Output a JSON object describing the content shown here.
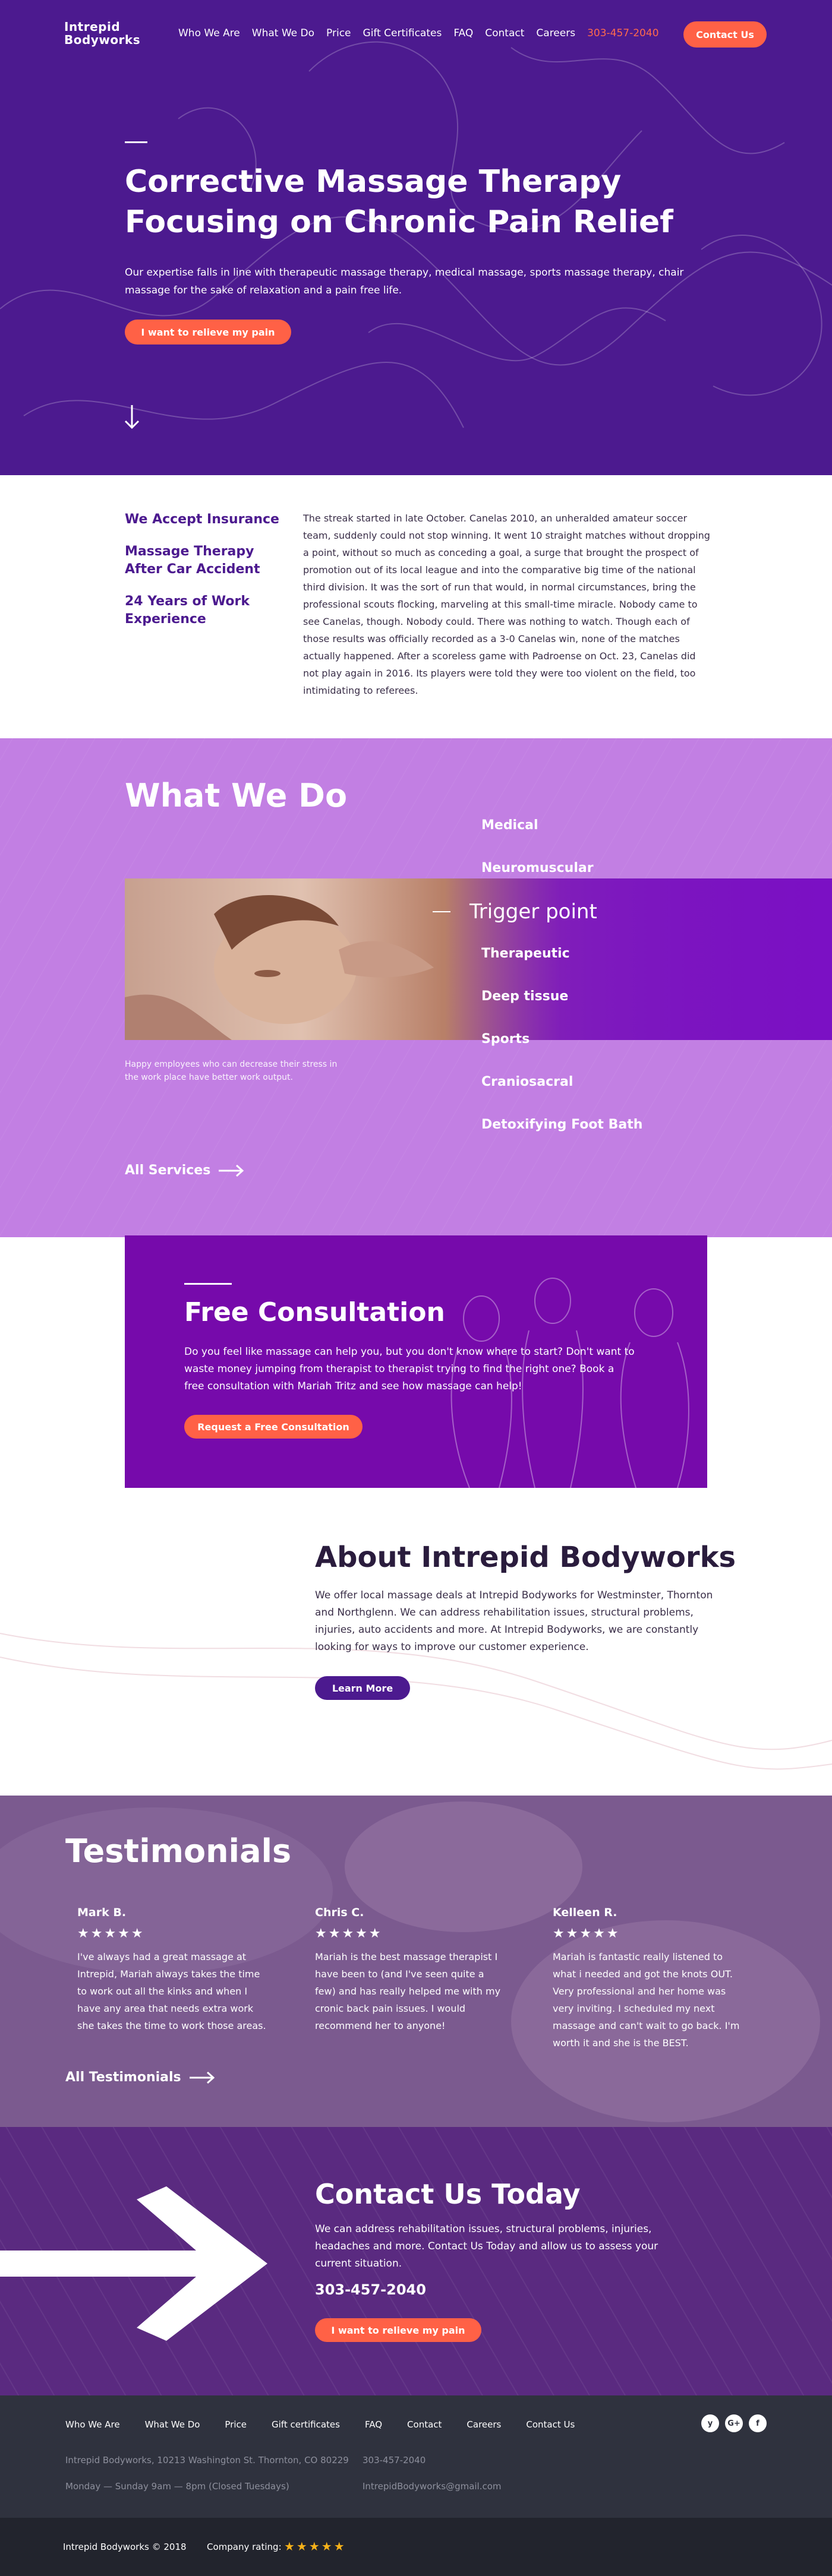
{
  "header": {
    "logo_line1": "Intrepid",
    "logo_line2": "Bodyworks",
    "nav": [
      "Who We Are",
      "What We Do",
      "Price",
      "Gift Certificates",
      "FAQ",
      "Contact",
      "Careers"
    ],
    "phone": "303-457-2040",
    "contact_button": "Contact Us"
  },
  "hero": {
    "title": "Corrective Massage Therapy Focusing on Chronic Pain Relief",
    "subtitle": "Our expertise falls in line with therapeutic massage therapy, medical massage, sports massage therapy, chair massage for the sake of relaxation and a pain free life.",
    "cta": "I want to relieve my pain"
  },
  "features": {
    "items": [
      "We Accept Insurance",
      "Massage Therapy After Car Accident",
      "24 Years of Work Experience"
    ],
    "text": "The streak started in late October. Canelas 2010, an unheralded amateur soccer team, suddenly could not stop winning. It went 10 straight matches without dropping a point, without so much as conceding a goal, a surge that brought the prospect of promotion out of its local league and into the comparative big time of the national third division. It was the sort of run that would, in normal circumstances, bring the professional scouts flocking, marveling at this small-time miracle. Nobody came to see Canelas, though. Nobody could. There was nothing to watch. Though each of those results was officially recorded as a 3-0 Canelas win, none of the matches actually happened. After a scoreless game with Padroense on Oct. 23, Canelas did not play again in 2016. Its players were told they were too violent on the field, too intimidating to referees."
  },
  "what_we_do": {
    "title": "What We Do",
    "services": [
      "Medical",
      "Neuromuscular",
      "Trigger point",
      "Therapeutic",
      "Deep tissue",
      "Sports",
      "Craniosacral",
      "Detoxifying Foot Bath"
    ],
    "active_service": "Trigger point",
    "caption": "Happy employees who can decrease their stress in the work place have better work output.",
    "all_link": "All Services"
  },
  "free_consultation": {
    "title": "Free Consultation",
    "text": "Do you feel like massage can help you, but you don't know where to start? Don't want to waste money jumping from therapist to therapist trying to find the right one? Book a free consultation with Mariah Tritz and see how massage can help!",
    "cta": "Request a Free Consultation"
  },
  "about": {
    "title": "About Intrepid Bodyworks",
    "text": "We offer local massage deals at Intrepid Bodyworks for Westminster, Thornton and Northglenn. We can address rehabilitation issues, structural problems, injuries, auto accidents and more. At Intrepid Bodyworks, we are constantly looking for ways to improve our customer experience.",
    "cta": "Learn More"
  },
  "testimonials": {
    "title": "Testimonials",
    "items": [
      {
        "name": "Mark B.",
        "stars": "★★★★★",
        "quote": "I've always had a great massage at Intrepid, Mariah always takes the time to work out all the kinks and when I have any area that needs extra work she takes the time to work those areas."
      },
      {
        "name": "Chris C.",
        "stars": "★★★★★",
        "quote": "Mariah is the best massage therapist I have been to (and I've seen quite a few) and has really helped me with my cronic back pain issues.  I would recommend her to anyone!"
      },
      {
        "name": "Kelleen R.",
        "stars": "★★★★★",
        "quote": "Mariah is fantastic really listened to what i needed and got the knots OUT.  Very professional and her home was very inviting.  I scheduled my next massage and can't wait to go back.  I'm worth it and she is the BEST."
      }
    ],
    "all_link": "All Testimonials"
  },
  "contact_today": {
    "title": "Contact Us Today",
    "text": "We can address rehabilitation issues, structural problems, injuries, headaches and more. Contact Us Today and allow us to assess your current situation.",
    "phone": "303-457-2040",
    "cta": "I want to relieve my pain"
  },
  "footer": {
    "nav": [
      "Who We Are",
      "What We Do",
      "Price",
      "Gift certificates",
      "FAQ",
      "Contact",
      "Careers",
      "Contact Us"
    ],
    "address": "Intrepid Bodyworks, 10213 Washington St. Thornton, CO 80229",
    "hours": "Monday — Sunday 9am — 8pm (Closed Tuesdays)",
    "phone": "303-457-2040",
    "email": "IntrepidBodyworks@gmail.com",
    "social": [
      "yelp-icon",
      "google-plus-icon",
      "facebook-icon"
    ],
    "copyright": "Intrepid Bodyworks © 2018",
    "rating_label": "Company rating:",
    "rating_stars": "★★★★★"
  },
  "colors": {
    "primary_purple": "#4c1a8f",
    "accent_orange": "#ff6146",
    "lilac": "#c27fe3",
    "consult_purple": "#760aab"
  }
}
